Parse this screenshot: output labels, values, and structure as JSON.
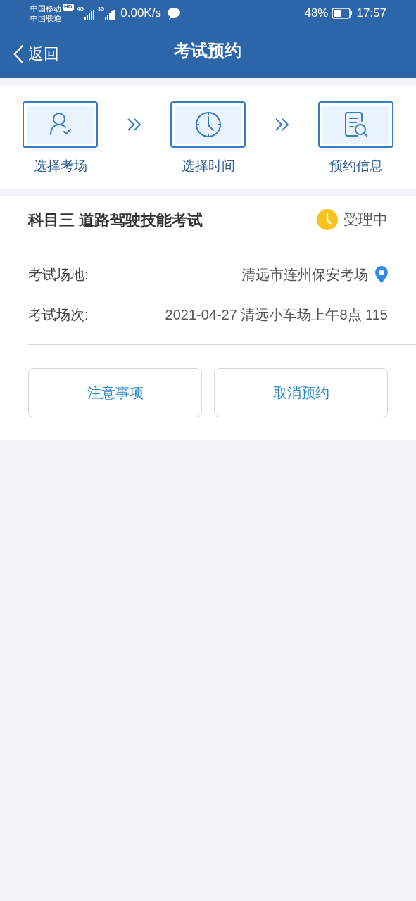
{
  "status_bar": {
    "carriers": [
      "中国移动",
      "中国联通"
    ],
    "hd_badge": "HD",
    "networks": [
      "4G",
      "3G"
    ],
    "speed": "0.00K/s",
    "battery": "48%",
    "time": "17:57"
  },
  "header": {
    "back": "返回",
    "title": "考试预约"
  },
  "steps": [
    {
      "kind": "person",
      "label": "选择考场"
    },
    {
      "kind": "clock",
      "label": "选择时间"
    },
    {
      "kind": "document",
      "label": "预约信息"
    }
  ],
  "exam": {
    "title": "科目三 道路驾驶技能考试",
    "status": "受理中",
    "rows": [
      {
        "kind": "place",
        "label": "考试场地:",
        "value": "清远市连州保安考场"
      },
      {
        "kind": "plain",
        "label": "考试场次:",
        "value": "2021-04-27 清远小车场上午8点 115"
      }
    ],
    "buttons": [
      "注意事项",
      "取消预约"
    ]
  }
}
